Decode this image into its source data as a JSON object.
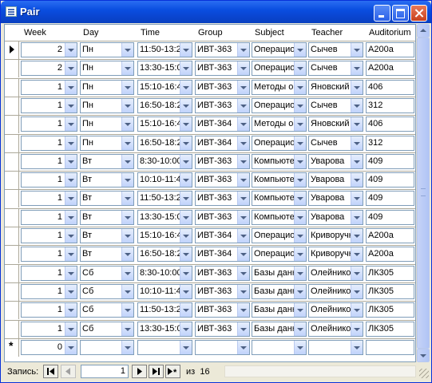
{
  "window": {
    "title": "Pair"
  },
  "columns": [
    "Week",
    "Day",
    "Time",
    "Group",
    "Subject",
    "Teacher",
    "Auditorium"
  ],
  "rows": [
    {
      "week": "2",
      "day": "Пн",
      "time": "11:50-13:2",
      "group": "ИВТ-363",
      "subject": "Операцио",
      "teacher": "Сычев",
      "auditorium": "A200a"
    },
    {
      "week": "2",
      "day": "Пн",
      "time": "13:30-15:0",
      "group": "ИВТ-363",
      "subject": "Операцио",
      "teacher": "Сычев",
      "auditorium": "A200a"
    },
    {
      "week": "1",
      "day": "Пн",
      "time": "15:10-16:4",
      "group": "ИВТ-363",
      "subject": "Методы о",
      "teacher": "Яновский",
      "auditorium": "406"
    },
    {
      "week": "1",
      "day": "Пн",
      "time": "16:50-18:2",
      "group": "ИВТ-363",
      "subject": "Операцио",
      "teacher": "Сычев",
      "auditorium": "312"
    },
    {
      "week": "1",
      "day": "Пн",
      "time": "15:10-16:4",
      "group": "ИВТ-364",
      "subject": "Методы о",
      "teacher": "Яновский",
      "auditorium": "406"
    },
    {
      "week": "1",
      "day": "Пн",
      "time": "16:50-18:2",
      "group": "ИВТ-364",
      "subject": "Операцио",
      "teacher": "Сычев",
      "auditorium": "312"
    },
    {
      "week": "1",
      "day": "Вт",
      "time": "8:30-10:00",
      "group": "ИВТ-363",
      "subject": "Компьюте",
      "teacher": "Уварова",
      "auditorium": "409"
    },
    {
      "week": "1",
      "day": "Вт",
      "time": "10:10-11:4",
      "group": "ИВТ-363",
      "subject": "Компьюте",
      "teacher": "Уварова",
      "auditorium": "409"
    },
    {
      "week": "1",
      "day": "Вт",
      "time": "11:50-13:2",
      "group": "ИВТ-363",
      "subject": "Компьюте",
      "teacher": "Уварова",
      "auditorium": "409"
    },
    {
      "week": "1",
      "day": "Вт",
      "time": "13:30-15:0",
      "group": "ИВТ-363",
      "subject": "Компьюте",
      "teacher": "Уварова",
      "auditorium": "409"
    },
    {
      "week": "1",
      "day": "Вт",
      "time": "15:10-16:4",
      "group": "ИВТ-364",
      "subject": "Операцио",
      "teacher": "Криворучк",
      "auditorium": "A200a"
    },
    {
      "week": "1",
      "day": "Вт",
      "time": "16:50-18:2",
      "group": "ИВТ-364",
      "subject": "Операцио",
      "teacher": "Криворучк",
      "auditorium": "A200a"
    },
    {
      "week": "1",
      "day": "Сб",
      "time": "8:30-10:00",
      "group": "ИВТ-363",
      "subject": "Базы данн",
      "teacher": "Олейнико",
      "auditorium": "ЛК305"
    },
    {
      "week": "1",
      "day": "Сб",
      "time": "10:10-11:4",
      "group": "ИВТ-363",
      "subject": "Базы данн",
      "teacher": "Олейнико",
      "auditorium": "ЛК305"
    },
    {
      "week": "1",
      "day": "Сб",
      "time": "11:50-13:2",
      "group": "ИВТ-363",
      "subject": "Базы данн",
      "teacher": "Олейнико",
      "auditorium": "ЛК305"
    },
    {
      "week": "1",
      "day": "Сб",
      "time": "13:30-15:0",
      "group": "ИВТ-363",
      "subject": "Базы данн",
      "teacher": "Олейнико",
      "auditorium": "ЛК305"
    }
  ],
  "new_row": {
    "week": "0",
    "day": "",
    "time": "",
    "group": "",
    "subject": "",
    "teacher": "",
    "auditorium": ""
  },
  "navigator": {
    "label": "Запись:",
    "current": "1",
    "of_label": "из",
    "total": "16"
  },
  "icons": {
    "window": "form-icon",
    "minimize": "minimize-icon",
    "maximize": "maximize-icon",
    "close": "close-icon",
    "first": "first-record-icon",
    "prev": "previous-record-icon",
    "next": "next-record-icon",
    "last": "last-record-icon",
    "new": "new-record-icon",
    "current_row": "current-row-arrow-icon",
    "new_row": "new-row-asterisk-icon"
  }
}
